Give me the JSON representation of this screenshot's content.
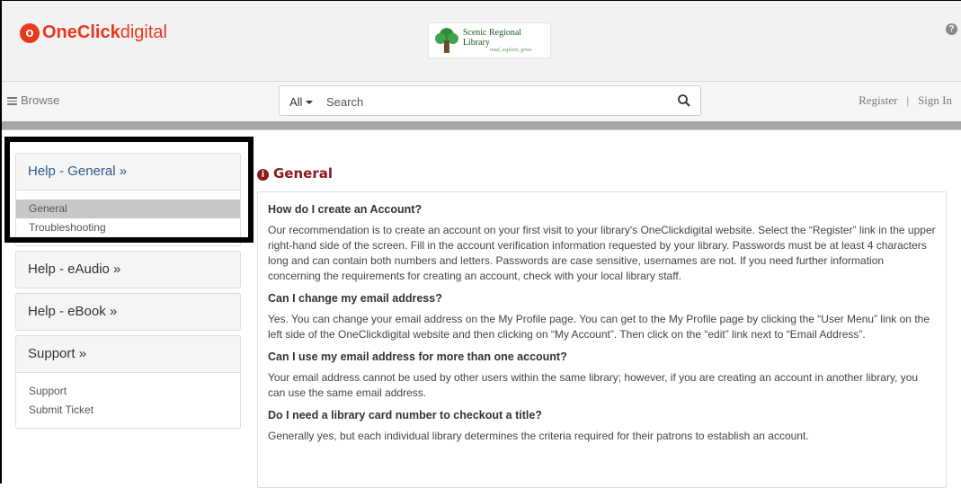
{
  "header": {
    "logo_prefix": "OneClick",
    "logo_suffix": "digital",
    "library": {
      "name": "Scenic Regional Library",
      "tagline": "read, explore, grow"
    },
    "help_icon": "question-circle-icon"
  },
  "navbar": {
    "browse_label": "Browse",
    "search_filter": "All",
    "search_placeholder": "Search",
    "register_label": "Register",
    "signin_label": "Sign In"
  },
  "sidebar": {
    "panels": [
      {
        "label": "Help - General »",
        "items": [
          "General",
          "Troubleshooting"
        ]
      },
      {
        "label": "Help - eAudio »"
      },
      {
        "label": "Help - eBook »"
      },
      {
        "label": "Support »",
        "items": [
          "Support",
          "Submit Ticket"
        ]
      }
    ]
  },
  "content": {
    "title": "General",
    "faq": [
      {
        "q": "How do I create an Account?",
        "a": "Our recommendation is to create an account on your first visit to your library's OneClickdigital website. Select the “Register” link in the upper right-hand side of the screen. Fill in the account verification information requested by your library. Passwords must be at least 4 characters long and can contain both numbers and letters. Passwords are case sensitive, usernames are not. If you need further information concerning the requirements for creating an account, check with your local library staff."
      },
      {
        "q": "Can I change my email address?",
        "a": "Yes. You can change your email address on the My Profile page. You can get to the My Profile page by clicking the “User Menu” link on the left side of the OneClickdigital website and then clicking on “My Account”. Then click on the “edit” link next to “Email Address”."
      },
      {
        "q": "Can I use my email address for more than one account?",
        "a": "Your email address cannot be used by other users within the same library; however, if you are creating an account in another library, you can use the same email address."
      },
      {
        "q": "Do I need a library card number to checkout a title?",
        "a": "Generally yes, but each individual library determines the criteria required for their patrons to establish an account."
      }
    ]
  },
  "colors": {
    "brand": "#e8381d",
    "title": "#8b1a1a",
    "active_link": "#2c5a8c",
    "highlight": "#000000"
  }
}
